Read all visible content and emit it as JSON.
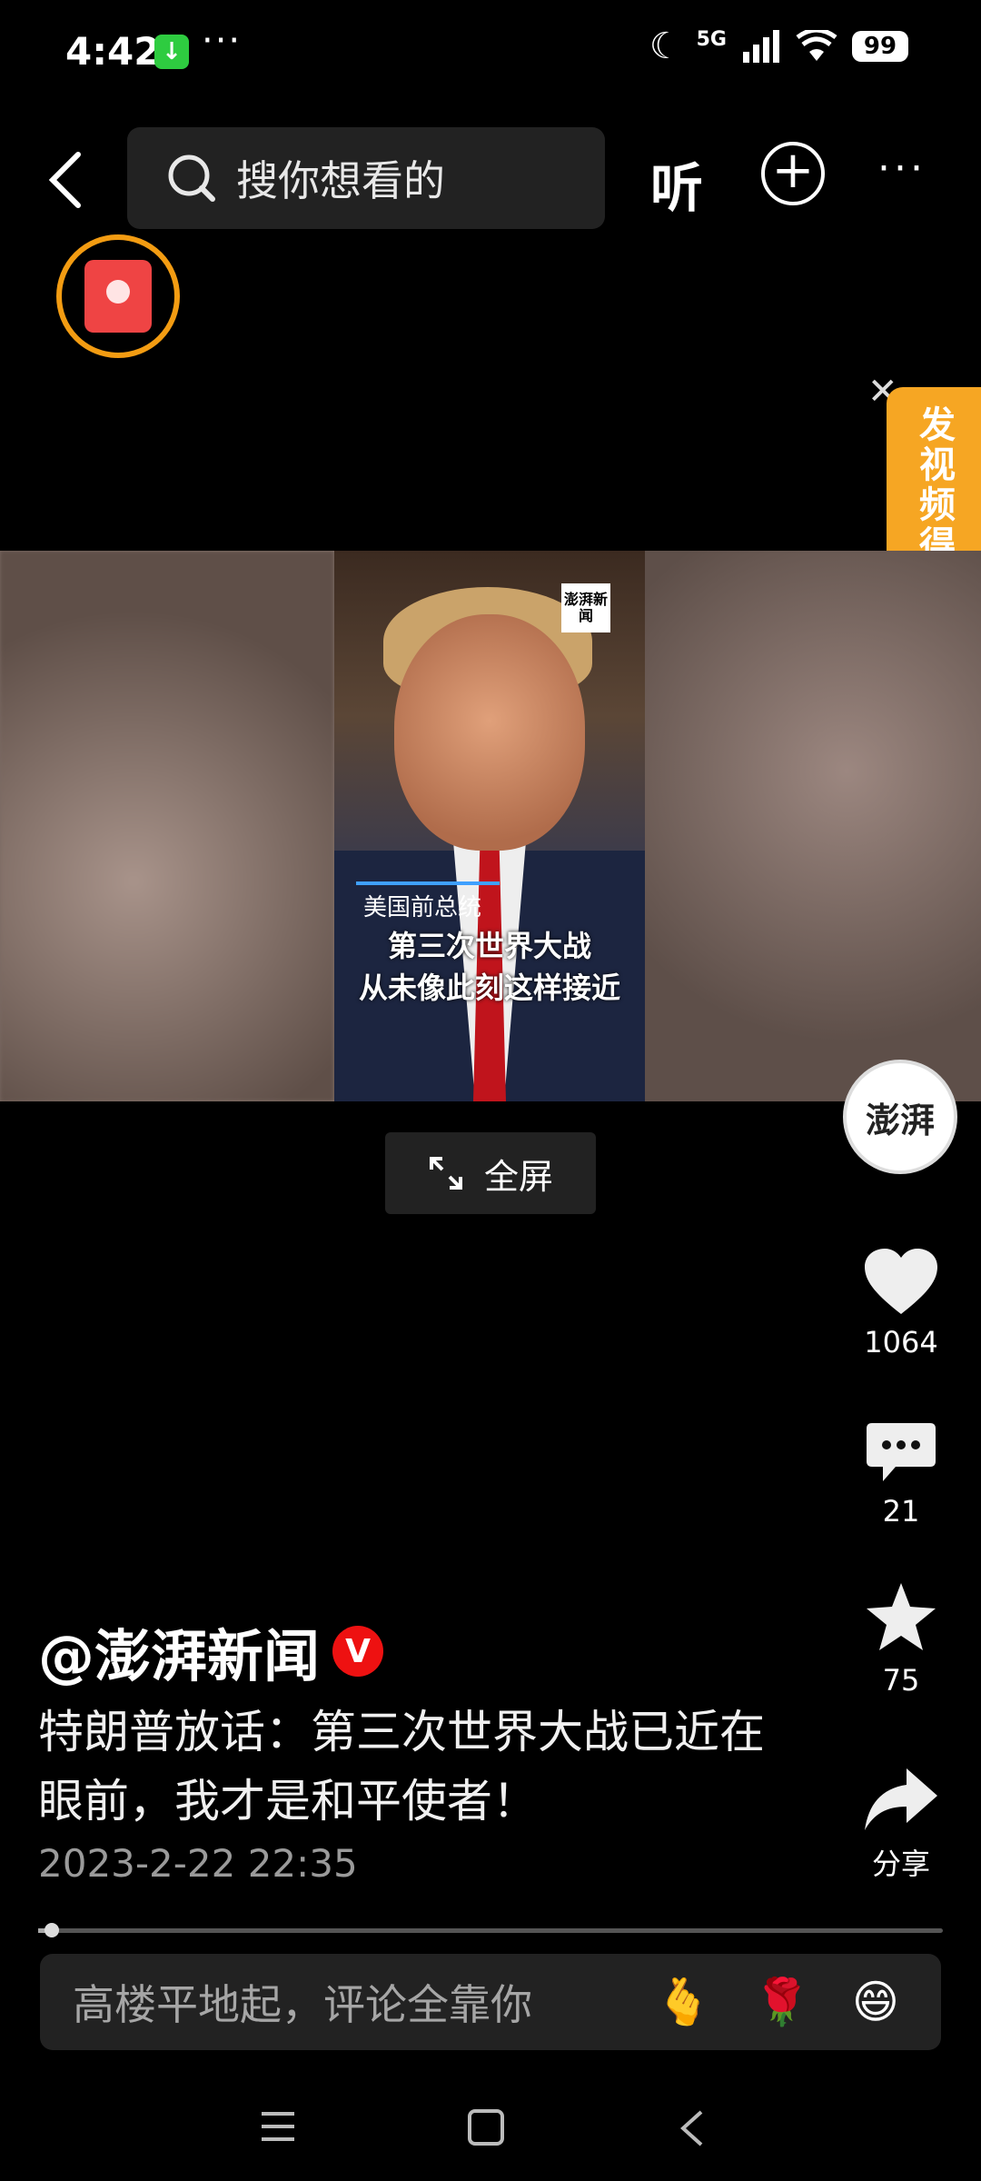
{
  "status_bar": {
    "time": "4:42",
    "network": "5G",
    "battery": "99"
  },
  "top_bar": {
    "search_placeholder": "搜你想看的",
    "listen_label": "听"
  },
  "promo": {
    "text": "发视频得奖"
  },
  "video": {
    "logo_text": "澎湃新闻",
    "caption_small": "美国前总统",
    "caption_line1": "第三次世界大战",
    "caption_line2": "从未像此刻这样接近"
  },
  "fullscreen_label": "全屏",
  "right_rail": {
    "avatar_text": "澎湃",
    "likes": "1064",
    "comments": "21",
    "favorites": "75",
    "share_label": "分享"
  },
  "post": {
    "author": "@澎湃新闻",
    "verified_badge": "V",
    "description": "特朗普放话：第三次世界大战已近在眼前，我才是和平使者！",
    "date": "2023-2-22 22:35"
  },
  "progress": {
    "fraction": 0.015
  },
  "comment_bar": {
    "placeholder": "高楼平地起，评论全靠你",
    "emojis": [
      "🫰",
      "🌹",
      "😄"
    ]
  }
}
